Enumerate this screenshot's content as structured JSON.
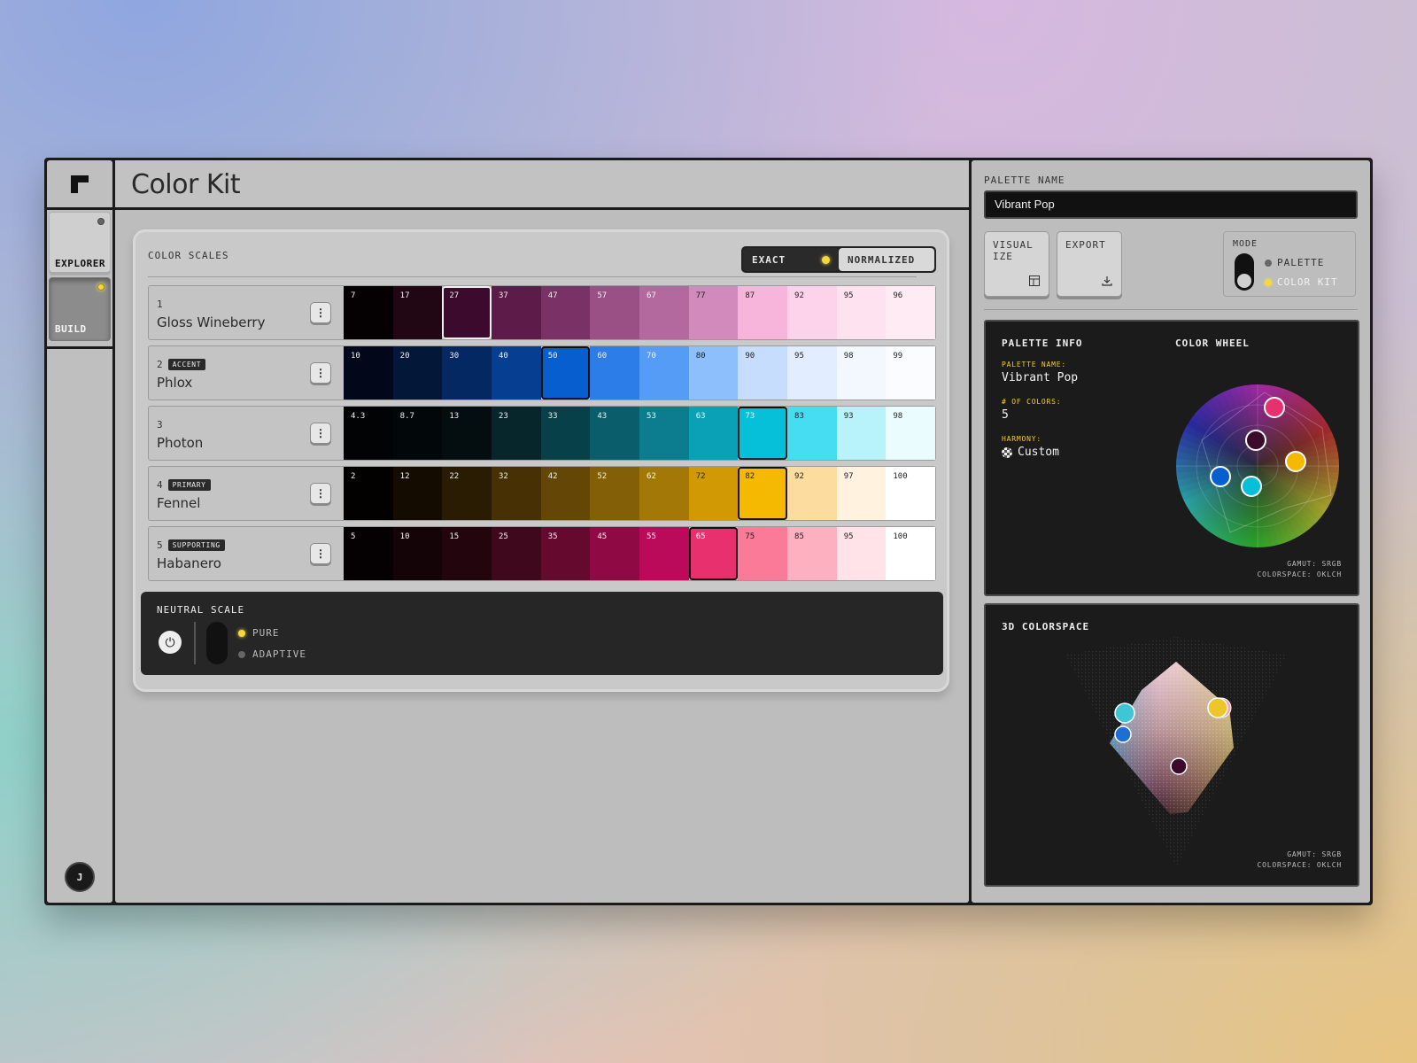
{
  "app": {
    "title": "Color Kit",
    "nav": [
      {
        "label": "EXPLORER",
        "active": false
      },
      {
        "label": "BUILD",
        "active": true
      }
    ],
    "avatar": "J"
  },
  "scales": {
    "heading": "COLOR SCALES",
    "toggle": {
      "exact": "EXACT",
      "normalized": "NORMALIZED",
      "selected": "exact"
    },
    "rows": [
      {
        "num": "1",
        "badge": "",
        "name": "Gloss Wineberry",
        "steps": [
          "7",
          "17",
          "27",
          "37",
          "47",
          "57",
          "67",
          "77",
          "87",
          "92",
          "95",
          "96"
        ],
        "colors": [
          "#050103",
          "#200713",
          "#3c0a2c",
          "#5c1b48",
          "#7a3166",
          "#9a4f85",
          "#b4699e",
          "#d289bb",
          "#f7b5dc",
          "#fcd3ea",
          "#fee2f0",
          "#ffebf4"
        ],
        "selected": 2
      },
      {
        "num": "2",
        "badge": "ACCENT",
        "name": "Phlox",
        "steps": [
          "10",
          "20",
          "30",
          "40",
          "50",
          "60",
          "70",
          "80",
          "90",
          "95",
          "98",
          "99"
        ],
        "colors": [
          "#02081a",
          "#031739",
          "#042862",
          "#063e92",
          "#075fcf",
          "#2c7de8",
          "#559cf7",
          "#8dbffc",
          "#c6ddfe",
          "#e2eeff",
          "#f3f8ff",
          "#fafcff"
        ],
        "selected": 4
      },
      {
        "num": "3",
        "badge": "",
        "name": "Photon",
        "steps": [
          "4.3",
          "8.7",
          "13",
          "23",
          "33",
          "43",
          "53",
          "63",
          "73",
          "83",
          "93",
          "98"
        ],
        "colors": [
          "#010304",
          "#020809",
          "#040d10",
          "#06262b",
          "#08404a",
          "#0a5e6c",
          "#0b7d8e",
          "#0aa0b5",
          "#06bfd8",
          "#46dcf2",
          "#b8f3fc",
          "#eafcfe"
        ],
        "selected": 8
      },
      {
        "num": "4",
        "badge": "PRIMARY",
        "name": "Fennel",
        "steps": [
          "2",
          "12",
          "22",
          "32",
          "42",
          "52",
          "62",
          "72",
          "82",
          "92",
          "97",
          "100"
        ],
        "colors": [
          "#020100",
          "#140c00",
          "#2a1c03",
          "#463004",
          "#644606",
          "#835f07",
          "#a47806",
          "#d19a05",
          "#f6b902",
          "#fddca0",
          "#fff3df",
          "#ffffff"
        ],
        "selected": 8
      },
      {
        "num": "5",
        "badge": "SUPPORTING",
        "name": "Habanero",
        "steps": [
          "5",
          "10",
          "15",
          "25",
          "35",
          "45",
          "55",
          "65",
          "75",
          "85",
          "95",
          "100"
        ],
        "colors": [
          "#050102",
          "#140307",
          "#22050d",
          "#40081c",
          "#66092e",
          "#8f0a45",
          "#bb0a5a",
          "#e9306f",
          "#fa7a97",
          "#fdb0bf",
          "#ffe3e8",
          "#ffffff"
        ],
        "selected": 7
      }
    ]
  },
  "neutral": {
    "heading": "NEUTRAL SCALE",
    "power_icon": "power-icon",
    "options": [
      {
        "label": "PURE",
        "active": true
      },
      {
        "label": "ADAPTIVE",
        "active": false
      }
    ]
  },
  "side": {
    "name_label": "PALETTE NAME",
    "name_value": "Vibrant Pop",
    "visualize_label": "VISUAL IZE",
    "export_label": "EXPORT",
    "mode_label": "MODE",
    "mode_options": [
      {
        "label": "PALETTE",
        "active": false
      },
      {
        "label": "COLOR KIT",
        "active": true
      }
    ]
  },
  "info": {
    "heading": "PALETTE INFO",
    "wheel_heading": "COLOR WHEEL",
    "name_key": "PALETTE NAME:",
    "name_val": "Vibrant Pop",
    "count_key": "# OF COLORS:",
    "count_val": "5",
    "harmony_key": "HARMONY:",
    "harmony_val": "Custom",
    "gamut": "GAMUT: SRGB",
    "colorspace": "COLORSPACE: OKLCH"
  },
  "space3d": {
    "heading": "3D COLORSPACE",
    "gamut": "GAMUT: SRGB",
    "colorspace": "COLORSPACE: OKLCH"
  },
  "colors": {
    "accent_led": "#f5d838",
    "wineberry": "#3c0a2c",
    "phlox": "#075fcf",
    "photon": "#06bfd8",
    "fennel": "#f6b902",
    "habanero": "#e9306f"
  }
}
